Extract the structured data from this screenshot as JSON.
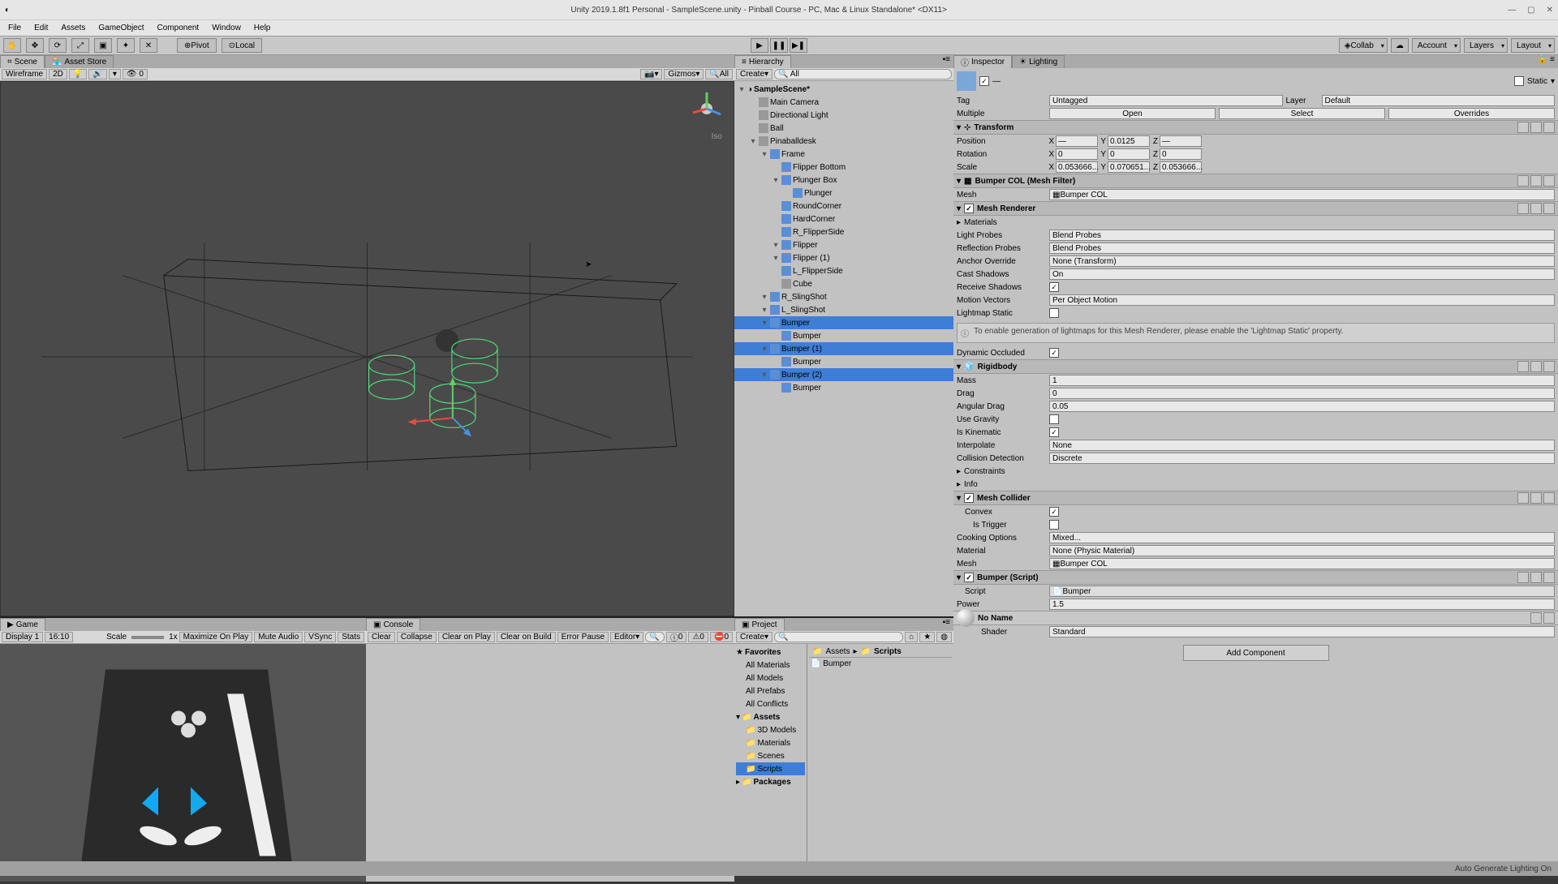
{
  "titlebar": {
    "title": "Unity 2019.1.8f1 Personal - SampleScene.unity - Pinball Course - PC, Mac & Linux Standalone* <DX11>"
  },
  "menu": [
    "File",
    "Edit",
    "Assets",
    "GameObject",
    "Component",
    "Window",
    "Help"
  ],
  "toolbar": {
    "pivot": "Pivot",
    "local": "Local",
    "collab": "Collab",
    "account": "Account",
    "layers": "Layers",
    "layout": "Layout"
  },
  "scene_tab": "Scene",
  "asset_store_tab": "Asset Store",
  "scene_bar": {
    "shading": "Wireframe",
    "d2": "2D",
    "gizmos": "Gizmos",
    "all": "All",
    "iso": "Iso"
  },
  "hierarchy": {
    "tab": "Hierarchy",
    "create": "Create",
    "all": "All",
    "items": [
      {
        "d": 0,
        "t": "SampleScene*",
        "unity": true
      },
      {
        "d": 1,
        "t": "Main Camera"
      },
      {
        "d": 1,
        "t": "Directional Light"
      },
      {
        "d": 1,
        "t": "Ball"
      },
      {
        "d": 1,
        "t": "Pinaballdesk",
        "arrow": true
      },
      {
        "d": 2,
        "t": "Frame",
        "arrow": true,
        "pf": true
      },
      {
        "d": 3,
        "t": "Flipper Bottom",
        "pf": true
      },
      {
        "d": 3,
        "t": "Plunger Box",
        "arrow": true,
        "pf": true
      },
      {
        "d": 4,
        "t": "Plunger",
        "pf": true
      },
      {
        "d": 3,
        "t": "RoundCorner",
        "pf": true
      },
      {
        "d": 3,
        "t": "HardCorner",
        "pf": true
      },
      {
        "d": 3,
        "t": "R_FlipperSide",
        "pf": true
      },
      {
        "d": 3,
        "t": "Flipper",
        "arrow": true,
        "pf": true
      },
      {
        "d": 3,
        "t": "Flipper (1)",
        "arrow": true,
        "pf": true
      },
      {
        "d": 3,
        "t": "L_FlipperSide",
        "pf": true
      },
      {
        "d": 3,
        "t": "Cube"
      },
      {
        "d": 2,
        "t": "R_SlingShot",
        "arrow": true,
        "pf": true
      },
      {
        "d": 2,
        "t": "L_SlingShot",
        "arrow": true,
        "pf": true
      },
      {
        "d": 2,
        "t": "Bumper",
        "arrow": true,
        "pf": true,
        "sel": true
      },
      {
        "d": 3,
        "t": "Bumper",
        "pf": true
      },
      {
        "d": 2,
        "t": "Bumper (1)",
        "arrow": true,
        "pf": true,
        "sel": true
      },
      {
        "d": 3,
        "t": "Bumper",
        "pf": true
      },
      {
        "d": 2,
        "t": "Bumper (2)",
        "arrow": true,
        "pf": true,
        "sel": true
      },
      {
        "d": 3,
        "t": "Bumper",
        "pf": true
      }
    ]
  },
  "game": {
    "tab": "Game",
    "display": "Display 1",
    "aspect": "16:10",
    "scale": "Scale",
    "scale_val": "1x",
    "maximize": "Maximize On Play",
    "mute": "Mute Audio",
    "vsync": "VSync",
    "stats": "Stats"
  },
  "console": {
    "tab": "Console",
    "clear": "Clear",
    "collapse": "Collapse",
    "clearplay": "Clear on Play",
    "clearbuild": "Clear on Build",
    "errorpause": "Error Pause",
    "editor": "Editor",
    "c0": "0",
    "c1": "0",
    "c2": "0"
  },
  "project": {
    "tab": "Project",
    "create": "Create",
    "favorites": "Favorites",
    "fav_items": [
      "All Materials",
      "All Models",
      "All Prefabs",
      "All Conflicts"
    ],
    "assets": "Assets",
    "asset_items": [
      "3D Models",
      "Materials",
      "Scenes",
      "Scripts"
    ],
    "packages": "Packages",
    "crumb_assets": "Assets",
    "crumb_scripts": "Scripts",
    "file": "Bumper"
  },
  "inspector": {
    "tab": "Inspector",
    "lighting_tab": "Lighting",
    "static": "Static",
    "dash": "—",
    "multiple": "Multiple",
    "open": "Open",
    "select": "Select",
    "overrides": "Overrides",
    "tag": "Tag",
    "tag_val": "Untagged",
    "layer": "Layer",
    "layer_val": "Default",
    "transform": "Transform",
    "pos": "Position",
    "rot": "Rotation",
    "scale": "Scale",
    "px": "—",
    "py": "0.0125",
    "pz": "—",
    "rx": "0",
    "ry": "0",
    "rz": "0",
    "sx": "0.053666...",
    "sy": "0.070651...",
    "sz": "0.053666...",
    "meshfilter": "Bumper COL (Mesh Filter)",
    "mesh": "Mesh",
    "mesh_val": "Bumper COL",
    "meshrenderer": "Mesh Renderer",
    "materials": "Materials",
    "lightprobes": "Light Probes",
    "lp_val": "Blend Probes",
    "reflprobes": "Reflection Probes",
    "rp_val": "Blend Probes",
    "anchor": "Anchor Override",
    "anchor_val": "None (Transform)",
    "castshad": "Cast Shadows",
    "cs_val": "On",
    "recshad": "Receive Shadows",
    "motionvec": "Motion Vectors",
    "mv_val": "Per Object Motion",
    "lightmapstatic": "Lightmap Static",
    "info": "To enable generation of lightmaps for this Mesh Renderer, please enable the 'Lightmap Static' property.",
    "dynocc": "Dynamic Occluded",
    "rigidbody": "Rigidbody",
    "mass": "Mass",
    "mass_v": "1",
    "drag": "Drag",
    "drag_v": "0",
    "angdrag": "Angular Drag",
    "angdrag_v": "0.05",
    "usegrav": "Use Gravity",
    "iskin": "Is Kinematic",
    "interp": "Interpolate",
    "interp_v": "None",
    "coldet": "Collision Detection",
    "coldet_v": "Discrete",
    "constraints": "Constraints",
    "info_row": "Info",
    "meshcol": "Mesh Collider",
    "convex": "Convex",
    "istrigger": "Is Trigger",
    "cookopt": "Cooking Options",
    "cookopt_v": "Mixed...",
    "material": "Material",
    "material_v": "None (Physic Material)",
    "mc_mesh": "Mesh",
    "mc_mesh_v": "Bumper COL",
    "bumperscript": "Bumper (Script)",
    "script": "Script",
    "script_v": "Bumper",
    "power": "Power",
    "power_v": "1.5",
    "noname": "No Name",
    "shader": "Shader",
    "shader_v": "Standard",
    "addcomp": "Add Component"
  },
  "status": "Auto Generate Lighting On"
}
